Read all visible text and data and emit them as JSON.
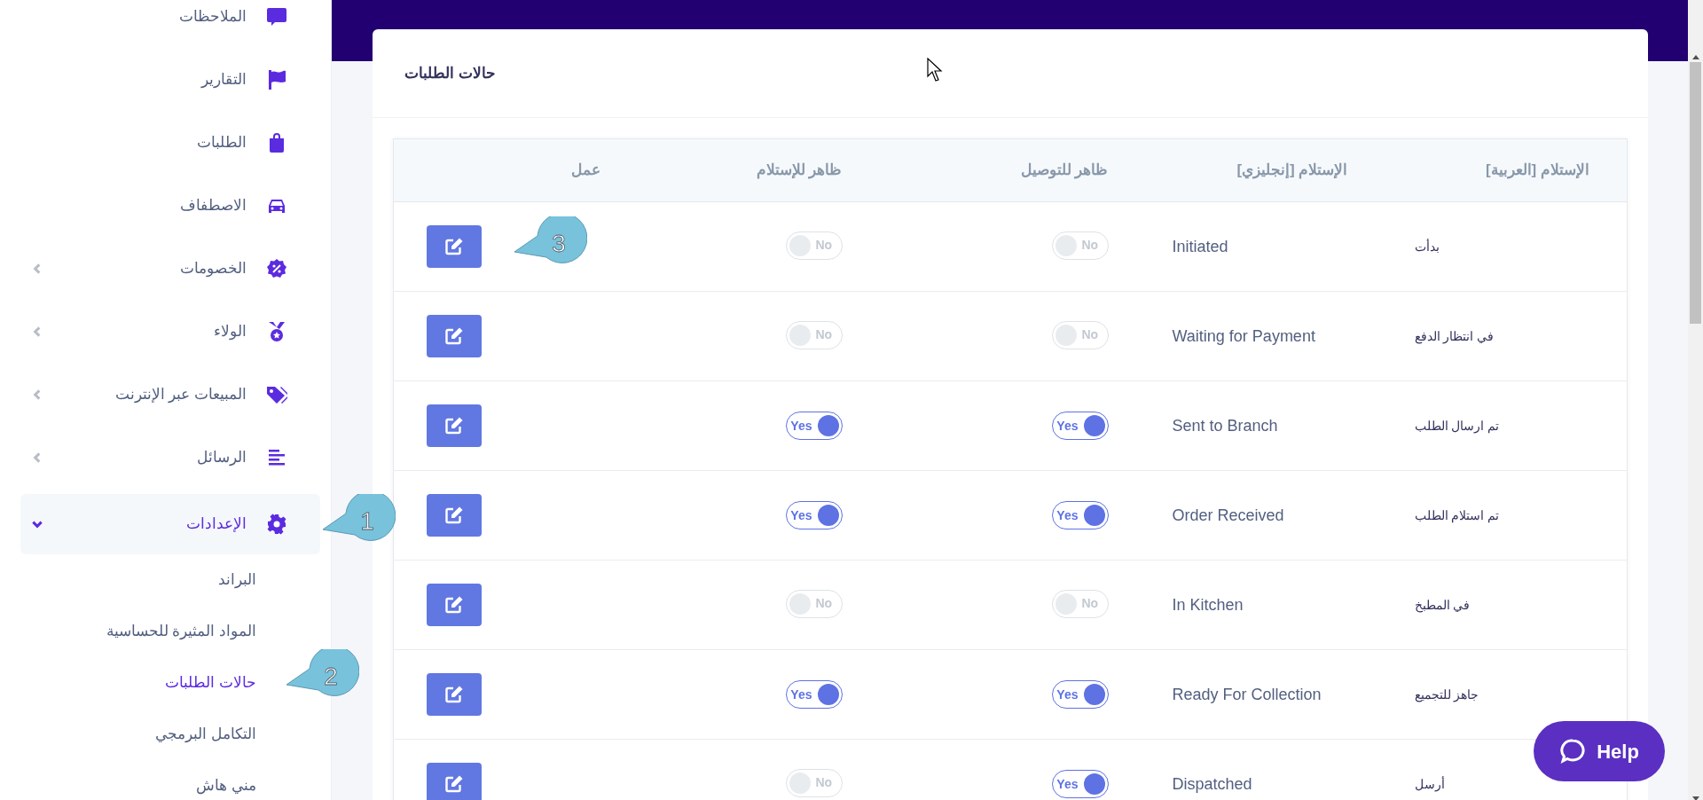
{
  "sidebar": {
    "items": [
      {
        "label": "الملاحظات",
        "selected": false
      },
      {
        "label": "التقارير",
        "selected": false
      },
      {
        "label": "الطلبات",
        "selected": false
      },
      {
        "label": "الاصطفاف",
        "selected": false
      },
      {
        "label": "الخصومات",
        "expandable": true,
        "expanded": false,
        "selected": false
      },
      {
        "label": "الولاء",
        "expandable": true,
        "expanded": false,
        "selected": false
      },
      {
        "label": "المبيعات عبر الإنترنت",
        "expandable": true,
        "expanded": false,
        "selected": false
      },
      {
        "label": "الرسائل",
        "expandable": true,
        "expanded": false,
        "selected": false
      },
      {
        "label": "الإعدادات",
        "expandable": true,
        "expanded": true,
        "selected": true,
        "children": [
          {
            "label": "البراند",
            "selected": false
          },
          {
            "label": "المواد المثيرة للحساسية",
            "selected": false
          },
          {
            "label": "حالات الطلبات",
            "selected": true
          },
          {
            "label": "التكامل البرمجي",
            "selected": false
          },
          {
            "label": "مني هاش",
            "selected": false
          }
        ]
      }
    ]
  },
  "card": {
    "title": "حالات الطلبات",
    "table": {
      "columns": [
        "الإستلام [العربية]",
        "الإستلام [إنجليزي]",
        "ظاهر للتوصيل",
        "ظاهر للإستلام",
        "عمل"
      ],
      "rows": [
        {
          "arabic": "بدأت",
          "english": "Initiated",
          "delivery": {
            "on": false,
            "label": "No"
          },
          "pickup": {
            "on": false,
            "label": "No"
          }
        },
        {
          "arabic": "في انتظار الدفع",
          "english": "Waiting for Payment",
          "delivery": {
            "on": false,
            "label": "No"
          },
          "pickup": {
            "on": false,
            "label": "No"
          }
        },
        {
          "arabic": "تم ارسال الطلب",
          "english": "Sent to Branch",
          "delivery": {
            "on": true,
            "label": "Yes"
          },
          "pickup": {
            "on": true,
            "label": "Yes"
          }
        },
        {
          "arabic": "تم استلام الطلب",
          "english": "Order Received",
          "delivery": {
            "on": true,
            "label": "Yes"
          },
          "pickup": {
            "on": true,
            "label": "Yes"
          }
        },
        {
          "arabic": "في المطبخ",
          "english": "In Kitchen",
          "delivery": {
            "on": false,
            "label": "No"
          },
          "pickup": {
            "on": false,
            "label": "No"
          }
        },
        {
          "arabic": "جاهز للتجميع",
          "english": "Ready For Collection",
          "delivery": {
            "on": true,
            "label": "Yes"
          },
          "pickup": {
            "on": true,
            "label": "Yes"
          }
        },
        {
          "arabic": "أرسل",
          "english": "Dispatched",
          "delivery": {
            "on": true,
            "label": "Yes"
          },
          "pickup": {
            "on": false,
            "label": "No"
          }
        }
      ]
    }
  },
  "callouts": [
    {
      "number": "1"
    },
    {
      "number": "2"
    },
    {
      "number": "3"
    }
  ],
  "help_button": {
    "label": "Help"
  }
}
